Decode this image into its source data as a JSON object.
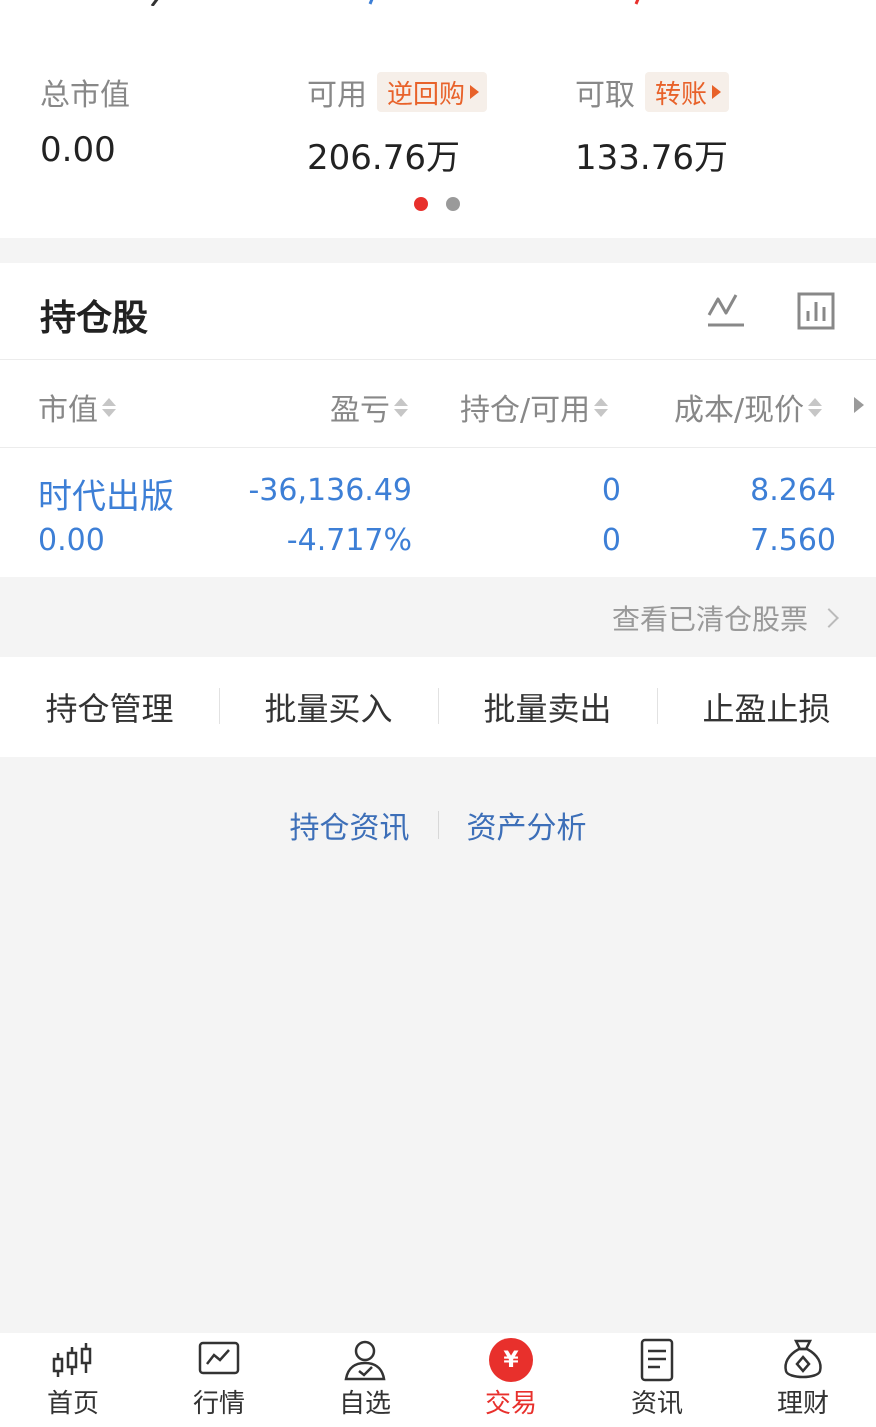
{
  "colors": {
    "accent": "#e8302c",
    "blue": "#3d7fd6",
    "orange": "#e8622a",
    "gray": "#888888"
  },
  "summary": {
    "market_value": {
      "label": "总市值",
      "value": "0.00"
    },
    "available": {
      "label": "可用",
      "action": "逆回购",
      "value": "206.76万"
    },
    "withdrawable": {
      "label": "可取",
      "action": "转账",
      "value": "133.76万"
    }
  },
  "holdings": {
    "title": "持仓股",
    "icons": [
      "line-chart-icon",
      "bar-chart-icon"
    ],
    "columns": [
      "市值",
      "盈亏",
      "持仓/可用",
      "成本/现价"
    ],
    "rows": [
      {
        "name": "时代出版",
        "market_value": "0.00",
        "pnl": "-36,136.49",
        "pnl_pct": "-4.717%",
        "position": "0",
        "available": "0",
        "cost": "8.264",
        "price": "7.560"
      }
    ]
  },
  "cleared_link": "查看已清仓股票",
  "actions": [
    "持仓管理",
    "批量买入",
    "批量卖出",
    "止盈止损"
  ],
  "links": [
    "持仓资讯",
    "资产分析"
  ],
  "nav": [
    {
      "label": "首页",
      "icon": "candlestick-icon"
    },
    {
      "label": "行情",
      "icon": "market-chart-icon"
    },
    {
      "label": "自选",
      "icon": "user-check-icon"
    },
    {
      "label": "交易",
      "icon": "yuan-icon",
      "active": true
    },
    {
      "label": "资讯",
      "icon": "document-icon"
    },
    {
      "label": "理财",
      "icon": "money-bag-icon"
    }
  ]
}
